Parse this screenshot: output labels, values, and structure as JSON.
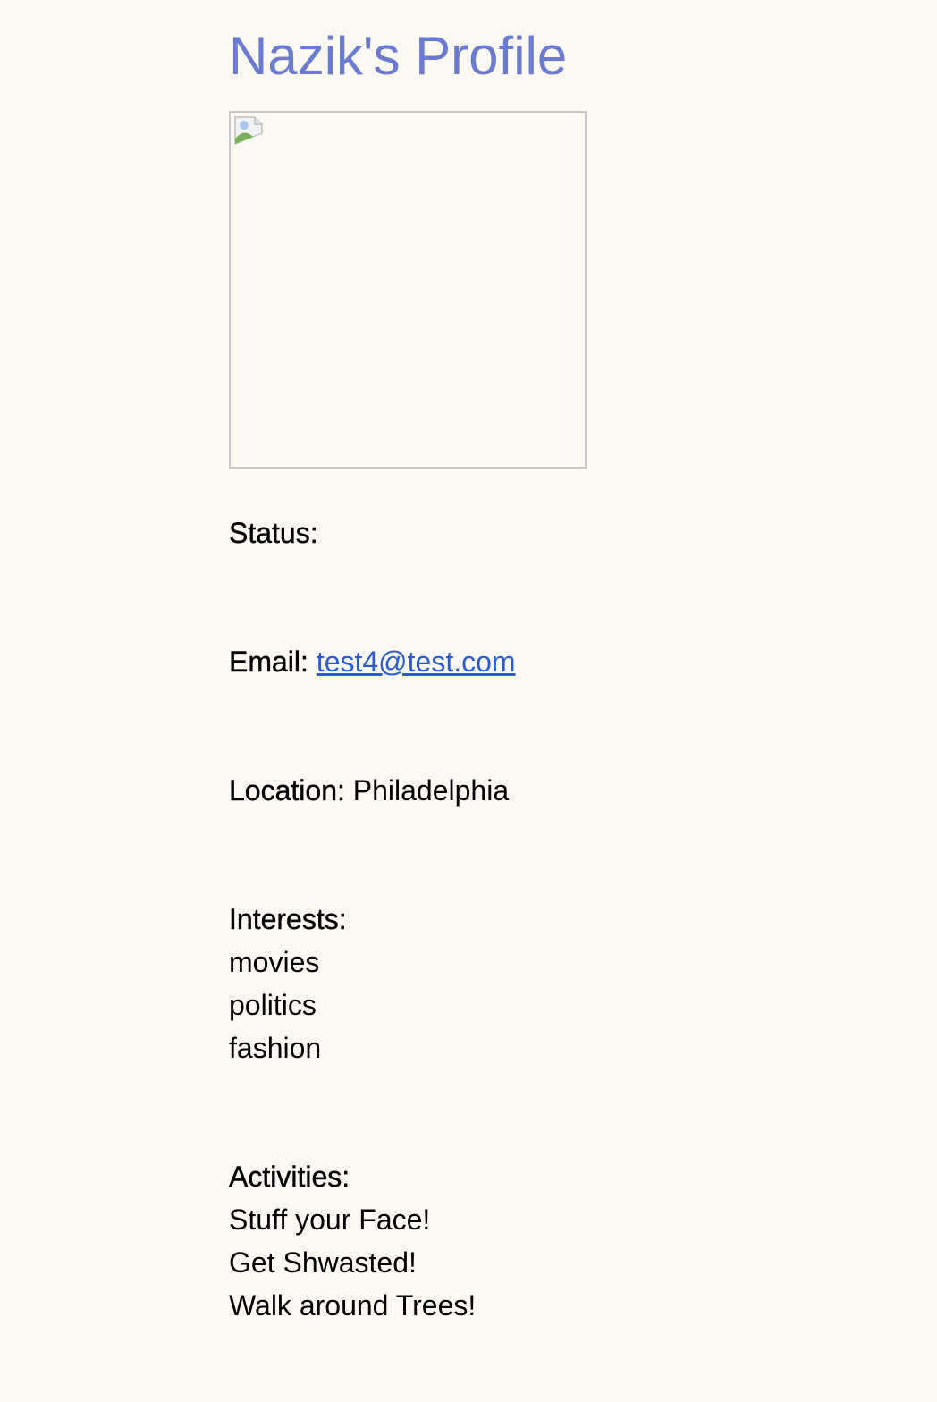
{
  "profile": {
    "title": "Nazik's Profile",
    "status_label": "Status:",
    "status_value": "",
    "email_label": "Email:",
    "email_value": "test4@test.com",
    "location_label": "Location:",
    "location_value": "Philadelphia",
    "interests_label": "Interests:",
    "interests": [
      "movies",
      "politics",
      "fashion"
    ],
    "activities_label": "Activities:",
    "activities": [
      "Stuff your Face!",
      "Get Shwasted!",
      "Walk around Trees!"
    ]
  },
  "colors": {
    "background": "#fbf9f2",
    "title": "#6a7bd1",
    "link": "#2a5bd7",
    "image_border": "#c8c8c8"
  },
  "icons": {
    "avatar_placeholder": "broken-image-icon"
  }
}
